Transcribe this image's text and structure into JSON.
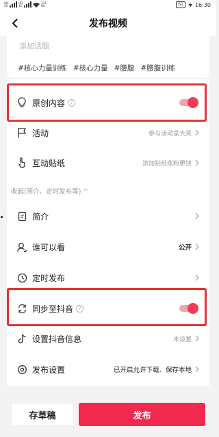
{
  "status_bar": {
    "sim1": "HD",
    "sim2": "HD",
    "net1": "4G",
    "net2": "4G",
    "net_speed": "211",
    "net_speed_unit": "B/s",
    "battery": "61",
    "time": "16:30"
  },
  "nav": {
    "back_icon": "chevron-left-icon",
    "title": "发布视频"
  },
  "topics": {
    "placeholder": "添加话题",
    "tags": [
      "#核心力量训练",
      "#核心力量",
      "#腰腹",
      "#腰腹训练"
    ]
  },
  "settings": {
    "original": {
      "label": "原创内容",
      "help": "?",
      "enabled": true,
      "icon": "lightbulb-icon"
    },
    "activity": {
      "label": "活动",
      "value": "参与活动拿大奖",
      "icon": "flag-icon"
    },
    "sticker": {
      "label": "互动贴纸",
      "value": "添加贴纸涨粉更快",
      "icon": "hand-pointer-icon"
    },
    "collapse_label": "收起(简介、定时发布等) ^",
    "intro": {
      "label": "简介",
      "icon": "document-icon"
    },
    "visibility": {
      "label": "谁可以看",
      "value": "公开",
      "icon": "user-icon"
    },
    "scheduled": {
      "label": "定时发布",
      "icon": "clock-icon"
    },
    "sync_douyin": {
      "label": "同步至抖音",
      "help": "?",
      "enabled": true,
      "icon": "sync-icon"
    },
    "douyin_info": {
      "label": "设置抖音信息",
      "value": "未设置",
      "icon": "douyin-icon"
    },
    "publish_settings": {
      "label": "发布设置",
      "value": "已开启允许下载、保存本地",
      "icon": "gear-icon"
    }
  },
  "bottom": {
    "draft_label": "存草稿",
    "publish_label": "发布"
  },
  "colors": {
    "accent": "#f2294f",
    "highlight": "#e53333",
    "toggle_track": "#f7a3ad"
  }
}
